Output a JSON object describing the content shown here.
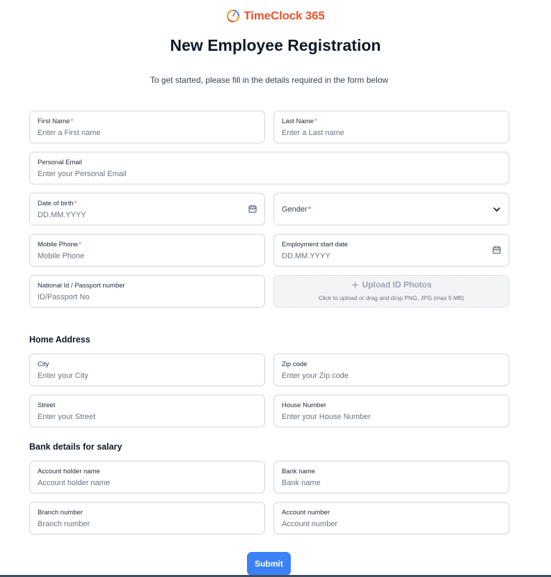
{
  "brand": {
    "name": "TimeClock 365",
    "accent": "#e8542b"
  },
  "page": {
    "title": "New Employee Registration",
    "subtitle": "To get started, please fill in the details required in the form below"
  },
  "required_mark": "*",
  "fields": {
    "first_name": {
      "label": "First Name",
      "placeholder": "Enter a First name"
    },
    "last_name": {
      "label": "Last Name",
      "placeholder": "Enter a Last name"
    },
    "personal_email": {
      "label": "Personal Email",
      "placeholder": "Enter your Personal Email"
    },
    "dob": {
      "label": "Date of birth",
      "placeholder": "DD.MM.YYYY",
      "icon": "calendar-icon"
    },
    "gender": {
      "label": "Gender",
      "icon": "chevron-down-icon"
    },
    "mobile": {
      "label": "Mobile Phone",
      "placeholder": "Mobile Phone"
    },
    "start_date": {
      "label": "Employment start date",
      "placeholder": "DD.MM.YYYY",
      "icon": "calendar-icon"
    },
    "national_id": {
      "label": "National Id / Passport number",
      "placeholder": "ID/Passport No"
    }
  },
  "upload": {
    "title": "Upload ID Photos",
    "hint": "Click to upload or drag and drop PNG, JPG (max 5 MB)",
    "icon": "plus-icon"
  },
  "home_address": {
    "title": "Home Address",
    "city": {
      "label": "City",
      "placeholder": "Enter your City"
    },
    "zip": {
      "label": "Zip code",
      "placeholder": "Enter your Zip code"
    },
    "street": {
      "label": "Street",
      "placeholder": "Enter your Street"
    },
    "house": {
      "label": "House Number",
      "placeholder": "Enter your House Number"
    }
  },
  "bank": {
    "title": "Bank details for salary",
    "holder": {
      "label": "Account holder name",
      "placeholder": "Account holder name"
    },
    "bank_name": {
      "label": "Bank name",
      "placeholder": "Bank name"
    },
    "branch": {
      "label": "Branch number",
      "placeholder": "Branch number"
    },
    "account": {
      "label": "Account number",
      "placeholder": "Account number"
    }
  },
  "submit_label": "Submit",
  "colors": {
    "primary": "#3b82f6",
    "required": "#ef4444",
    "border": "#d1d5db"
  }
}
